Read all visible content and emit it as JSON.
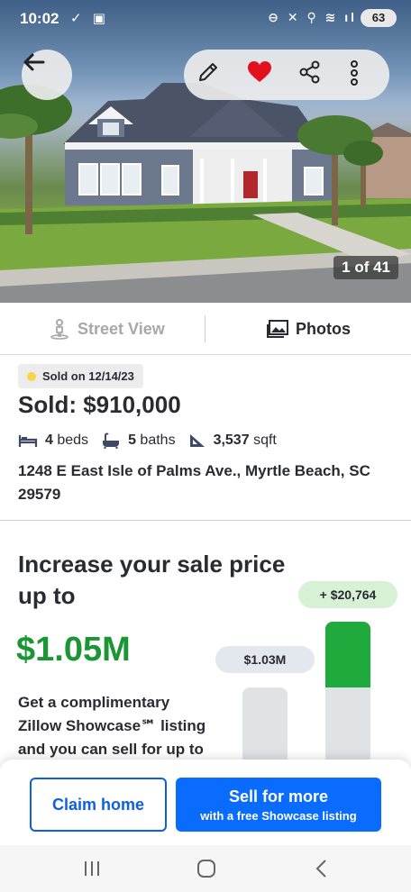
{
  "status_bar": {
    "time": "10:02",
    "left_icons": "✓ ▣",
    "right_icons": "⊖ ✕ ⚲ ≋ ıl",
    "battery": "63"
  },
  "hero": {
    "photo_counter": "1 of 41",
    "icons": [
      "back-arrow-icon",
      "pencil-icon",
      "heart-icon",
      "share-icon",
      "more-vertical-icon"
    ],
    "heart_color": "#e3101e"
  },
  "view_tabs": {
    "street_view": "Street View",
    "photos": "Photos"
  },
  "listing": {
    "sold_badge": "Sold on 12/14/23",
    "price": "Sold: $910,000",
    "beds_value": "4",
    "beds_label": "beds",
    "baths_value": "5",
    "baths_label": "baths",
    "sqft_value": "3,537",
    "sqft_label": "sqft",
    "address": "1248 E East Isle of Palms Ave., Myrtle Beach, SC 29579"
  },
  "promo": {
    "title": "Increase your sale price up to",
    "amount": "$1.05M",
    "body": "Get a complimentary Zillow Showcase℠ listing and you can sell for up to",
    "base_label": "$1.03M",
    "uplift_label": "+ $20,764",
    "accent": "#1a9634"
  },
  "cta": {
    "claim": "Claim home",
    "sell_title": "Sell for more",
    "sell_sub": "with a free Showcase listing",
    "primary_color": "#0a6cff"
  },
  "nav": {
    "icons": [
      "recent-apps-icon",
      "home-icon",
      "back-icon"
    ]
  }
}
